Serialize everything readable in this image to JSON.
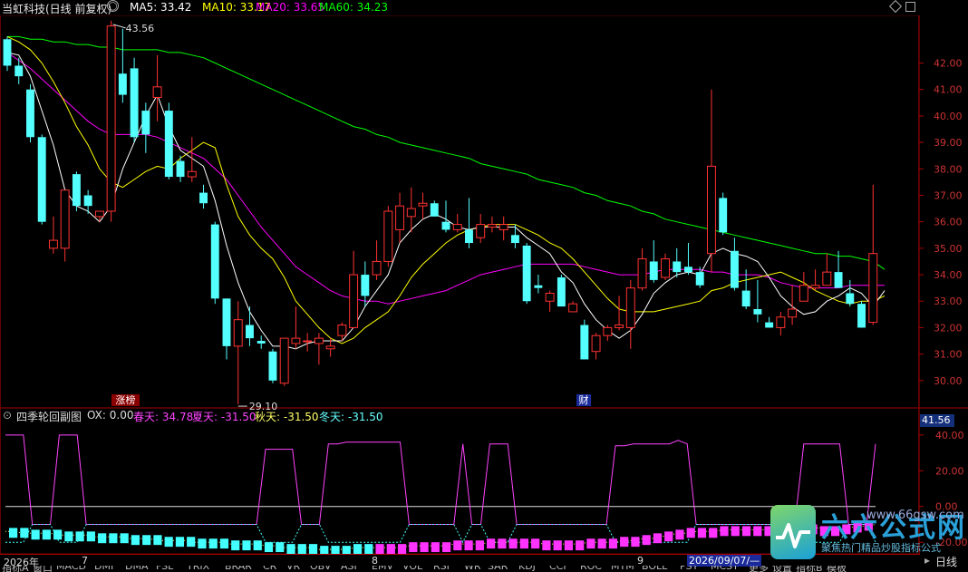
{
  "header": {
    "title": "当虹科技(日线 前复权)",
    "ma": [
      {
        "label": "MA5: 33.42",
        "color": "#ffffff"
      },
      {
        "label": "MA10: 33.17",
        "color": "#ffff00"
      },
      {
        "label": "MA20: 33.65",
        "color": "#ff00ff"
      },
      {
        "label": "MA60: 34.23",
        "color": "#00ff00"
      }
    ]
  },
  "main_axis": {
    "ticks": [
      "42.00",
      "41.00",
      "40.00",
      "39.00",
      "38.00",
      "37.00",
      "36.00",
      "35.00",
      "34.00",
      "33.00",
      "32.00",
      "31.00",
      "30.00"
    ],
    "high_label": "43.56",
    "low_label": "29.10"
  },
  "badges": {
    "zhangbang": "涨榜",
    "cai": "财"
  },
  "sub": {
    "title": "四季轮回副图",
    "ox": "OX: 0.00",
    "spring": "春天: 34.78",
    "summer": "夏天: -31.50",
    "autumn": "秋天: -31.50",
    "winter": "冬天: -31.50",
    "value_badge": "41.56",
    "ticks": [
      "40.00",
      "20.00",
      "0.00",
      "-20.00"
    ]
  },
  "datebar": {
    "year": "2026年",
    "m7": "7",
    "m8": "8",
    "m9": "9",
    "cursor": "2026/09/07/—"
  },
  "period_button": "日线",
  "tabs": [
    "指标A",
    "窗口",
    "MACD",
    "DMI",
    "DMA",
    "FSL",
    "TRIX",
    "BRAR",
    "CR",
    "VR",
    "OBV",
    "ASI",
    "EMV",
    "VOL",
    "RSI",
    "WR",
    "SAR",
    "KDJ",
    "CCI",
    "ROC",
    "MTM",
    "BOLL",
    "PSY",
    "MCST",
    "更多",
    "设置",
    "指标B",
    "模板"
  ],
  "logo": {
    "name": "六六公式网",
    "url": "www.66gsw.com",
    "slogan": "聚焦热门精品炒股指标公式"
  },
  "colors": {
    "up": "#ff3232",
    "down": "#54ffff",
    "ma5": "#ffffff",
    "ma10": "#ffff00",
    "ma20": "#ff00ff",
    "ma60": "#00ff00"
  },
  "chart_data": {
    "type": "candlestick",
    "ylim": [
      29.0,
      43.8
    ],
    "candles": [
      {
        "o": 42.9,
        "h": 43.0,
        "l": 41.7,
        "c": 41.9
      },
      {
        "o": 41.9,
        "h": 42.2,
        "l": 41.2,
        "c": 41.5
      },
      {
        "o": 41.0,
        "h": 41.2,
        "l": 39.0,
        "c": 39.2
      },
      {
        "o": 39.2,
        "h": 39.3,
        "l": 35.9,
        "c": 36.0
      },
      {
        "o": 35.0,
        "h": 36.2,
        "l": 34.8,
        "c": 35.3
      },
      {
        "o": 35.0,
        "h": 37.2,
        "l": 34.5,
        "c": 37.2
      },
      {
        "o": 37.8,
        "h": 37.9,
        "l": 36.4,
        "c": 36.6
      },
      {
        "o": 37.0,
        "h": 37.2,
        "l": 36.3,
        "c": 36.6
      },
      {
        "o": 36.2,
        "h": 36.4,
        "l": 36.0,
        "c": 36.4
      },
      {
        "o": 36.4,
        "h": 43.6,
        "l": 36.0,
        "c": 43.4
      },
      {
        "o": 41.6,
        "h": 43.3,
        "l": 40.5,
        "c": 40.8
      },
      {
        "o": 41.8,
        "h": 42.2,
        "l": 39.0,
        "c": 39.2
      },
      {
        "o": 40.2,
        "h": 40.5,
        "l": 38.6,
        "c": 39.3
      },
      {
        "o": 40.7,
        "h": 42.3,
        "l": 39.8,
        "c": 41.1
      },
      {
        "o": 40.2,
        "h": 40.5,
        "l": 37.6,
        "c": 37.7
      },
      {
        "o": 38.3,
        "h": 38.5,
        "l": 37.5,
        "c": 37.7
      },
      {
        "o": 37.7,
        "h": 39.2,
        "l": 37.5,
        "c": 37.9
      },
      {
        "o": 37.1,
        "h": 37.4,
        "l": 36.5,
        "c": 36.7
      },
      {
        "o": 35.9,
        "h": 36.0,
        "l": 32.9,
        "c": 33.1
      },
      {
        "o": 33.1,
        "h": 33.1,
        "l": 30.8,
        "c": 31.3
      },
      {
        "o": 31.3,
        "h": 33.0,
        "l": 29.1,
        "c": 32.3
      },
      {
        "o": 32.1,
        "h": 32.8,
        "l": 31.3,
        "c": 31.6
      },
      {
        "o": 31.5,
        "h": 31.7,
        "l": 31.2,
        "c": 31.4
      },
      {
        "o": 31.1,
        "h": 31.2,
        "l": 29.9,
        "c": 30.0
      },
      {
        "o": 29.9,
        "h": 31.5,
        "l": 29.8,
        "c": 31.6
      },
      {
        "o": 31.4,
        "h": 32.8,
        "l": 31.2,
        "c": 31.6
      },
      {
        "o": 31.5,
        "h": 31.8,
        "l": 31.1,
        "c": 31.5
      },
      {
        "o": 31.4,
        "h": 31.8,
        "l": 30.6,
        "c": 31.6
      },
      {
        "o": 31.2,
        "h": 31.6,
        "l": 30.9,
        "c": 31.3
      },
      {
        "o": 31.7,
        "h": 32.2,
        "l": 31.5,
        "c": 32.1
      },
      {
        "o": 32.0,
        "h": 34.9,
        "l": 32.0,
        "c": 34.0
      },
      {
        "o": 34.0,
        "h": 34.5,
        "l": 32.8,
        "c": 33.2
      },
      {
        "o": 34.0,
        "h": 35.3,
        "l": 33.8,
        "c": 34.5
      },
      {
        "o": 34.5,
        "h": 36.6,
        "l": 34.3,
        "c": 36.4
      },
      {
        "o": 35.7,
        "h": 37.1,
        "l": 35.2,
        "c": 36.6
      },
      {
        "o": 36.2,
        "h": 37.3,
        "l": 35.6,
        "c": 36.5
      },
      {
        "o": 36.6,
        "h": 37.1,
        "l": 36.1,
        "c": 36.7
      },
      {
        "o": 36.7,
        "h": 36.8,
        "l": 36.2,
        "c": 36.2
      },
      {
        "o": 36.0,
        "h": 36.8,
        "l": 35.6,
        "c": 35.7
      },
      {
        "o": 35.7,
        "h": 36.3,
        "l": 35.6,
        "c": 35.9
      },
      {
        "o": 35.7,
        "h": 36.9,
        "l": 35.0,
        "c": 35.2
      },
      {
        "o": 35.4,
        "h": 36.3,
        "l": 35.2,
        "c": 35.9
      },
      {
        "o": 35.8,
        "h": 36.2,
        "l": 35.6,
        "c": 35.9
      },
      {
        "o": 35.7,
        "h": 36.2,
        "l": 35.3,
        "c": 35.9
      },
      {
        "o": 35.5,
        "h": 35.9,
        "l": 35.0,
        "c": 35.2
      },
      {
        "o": 35.1,
        "h": 35.2,
        "l": 32.9,
        "c": 33.0
      },
      {
        "o": 33.6,
        "h": 34.0,
        "l": 33.3,
        "c": 33.5
      },
      {
        "o": 33.0,
        "h": 33.4,
        "l": 32.6,
        "c": 33.3
      },
      {
        "o": 33.9,
        "h": 34.0,
        "l": 32.8,
        "c": 32.8
      },
      {
        "o": 32.6,
        "h": 33.0,
        "l": 32.6,
        "c": 32.9
      },
      {
        "o": 32.1,
        "h": 32.3,
        "l": 31.0,
        "c": 30.8
      },
      {
        "o": 31.1,
        "h": 31.8,
        "l": 30.8,
        "c": 31.7
      },
      {
        "o": 31.7,
        "h": 32.1,
        "l": 31.5,
        "c": 32.0
      },
      {
        "o": 32.0,
        "h": 33.2,
        "l": 31.9,
        "c": 32.1
      },
      {
        "o": 32.0,
        "h": 33.8,
        "l": 31.2,
        "c": 33.5
      },
      {
        "o": 33.5,
        "h": 35.0,
        "l": 33.4,
        "c": 34.6
      },
      {
        "o": 34.5,
        "h": 35.3,
        "l": 33.7,
        "c": 33.8
      },
      {
        "o": 33.9,
        "h": 34.8,
        "l": 33.8,
        "c": 34.6
      },
      {
        "o": 34.5,
        "h": 35.0,
        "l": 33.9,
        "c": 34.1
      },
      {
        "o": 34.3,
        "h": 35.2,
        "l": 34.0,
        "c": 34.1
      },
      {
        "o": 34.1,
        "h": 34.3,
        "l": 33.5,
        "c": 33.6
      },
      {
        "o": 34.8,
        "h": 41.0,
        "l": 34.1,
        "c": 38.1
      },
      {
        "o": 36.9,
        "h": 37.1,
        "l": 35.5,
        "c": 35.6
      },
      {
        "o": 34.9,
        "h": 35.4,
        "l": 33.4,
        "c": 33.5
      },
      {
        "o": 33.4,
        "h": 34.2,
        "l": 32.7,
        "c": 32.8
      },
      {
        "o": 32.7,
        "h": 33.8,
        "l": 32.2,
        "c": 32.5
      },
      {
        "o": 32.2,
        "h": 32.4,
        "l": 32.0,
        "c": 32.0
      },
      {
        "o": 32.0,
        "h": 32.6,
        "l": 31.7,
        "c": 32.4
      },
      {
        "o": 32.4,
        "h": 33.6,
        "l": 32.1,
        "c": 32.7
      },
      {
        "o": 33.0,
        "h": 34.1,
        "l": 33.0,
        "c": 33.6
      },
      {
        "o": 33.5,
        "h": 34.2,
        "l": 33.4,
        "c": 33.6
      },
      {
        "o": 33.6,
        "h": 34.8,
        "l": 33.6,
        "c": 34.1
      },
      {
        "o": 34.1,
        "h": 34.9,
        "l": 33.7,
        "c": 33.5
      },
      {
        "o": 33.3,
        "h": 33.8,
        "l": 32.8,
        "c": 32.9
      },
      {
        "o": 32.9,
        "h": 33.0,
        "l": 32.0,
        "c": 32.0
      },
      {
        "o": 32.2,
        "h": 37.4,
        "l": 32.1,
        "c": 34.8
      }
    ],
    "ma5": [
      42.4,
      42.3,
      41.5,
      40.2,
      38.9,
      37.2,
      36.6,
      36.4,
      36.0,
      36.6,
      38.0,
      39.0,
      40.0,
      40.8,
      39.6,
      38.7,
      38.4,
      38.1,
      36.8,
      35.1,
      33.7,
      32.6,
      31.9,
      31.3,
      31.3,
      31.2,
      31.4,
      31.5,
      31.5,
      31.5,
      32.0,
      32.8,
      33.4,
      34.0,
      35.2,
      35.7,
      36.1,
      36.3,
      36.1,
      35.8,
      35.7,
      35.8,
      35.8,
      35.8,
      35.8,
      35.4,
      35.1,
      34.8,
      34.1,
      33.7,
      32.9,
      32.3,
      31.9,
      31.6,
      31.9,
      32.5,
      33.3,
      33.7,
      34.0,
      34.1,
      34.0,
      34.8,
      35.0,
      34.8,
      34.7,
      34.5,
      33.9,
      33.2,
      32.8,
      32.5,
      32.6,
      33.0,
      33.2,
      33.5,
      33.3,
      32.8,
      33.4
    ],
    "ma10": [
      43.0,
      42.8,
      42.5,
      42.0,
      41.3,
      40.5,
      39.6,
      38.9,
      38.0,
      37.5,
      37.3,
      37.6,
      37.9,
      38.1,
      38.0,
      38.4,
      38.7,
      39.0,
      38.8,
      37.4,
      36.2,
      35.5,
      35.0,
      34.6,
      33.9,
      33.0,
      32.5,
      32.0,
      31.6,
      31.4,
      31.6,
      32.0,
      32.3,
      32.6,
      33.2,
      33.9,
      34.4,
      34.8,
      35.2,
      35.5,
      35.7,
      35.8,
      35.9,
      35.9,
      35.9,
      35.7,
      35.5,
      35.2,
      35.0,
      34.6,
      34.1,
      33.6,
      33.1,
      32.7,
      32.6,
      32.6,
      32.6,
      32.7,
      32.8,
      32.9,
      33.0,
      33.4,
      33.5,
      33.7,
      33.8,
      33.9,
      34.0,
      34.1,
      33.9,
      33.7,
      33.4,
      33.2,
      33.0,
      32.9,
      33.0,
      33.0,
      33.2
    ],
    "ma20": [
      42.4,
      42.1,
      41.8,
      41.4,
      41.0,
      40.6,
      40.2,
      39.8,
      39.5,
      39.3,
      39.3,
      39.3,
      39.3,
      39.2,
      39.0,
      38.8,
      38.6,
      38.4,
      38.0,
      37.6,
      37.0,
      36.4,
      35.8,
      35.3,
      34.8,
      34.3,
      34.0,
      33.7,
      33.4,
      33.2,
      33.1,
      33.0,
      33.0,
      32.9,
      33.0,
      33.1,
      33.2,
      33.3,
      33.4,
      33.6,
      33.8,
      34.0,
      34.1,
      34.2,
      34.3,
      34.4,
      34.4,
      34.4,
      34.4,
      34.4,
      34.3,
      34.2,
      34.1,
      34.0,
      34.0,
      34.0,
      34.1,
      34.2,
      34.2,
      34.2,
      34.2,
      34.1,
      34.1,
      34.0,
      34.0,
      34.0,
      33.9,
      33.7,
      33.6,
      33.5,
      33.5,
      33.5,
      33.5,
      33.6,
      33.6,
      33.6,
      33.6
    ],
    "ma60": [
      43.0,
      43.0,
      42.9,
      42.9,
      42.8,
      42.8,
      42.7,
      42.7,
      42.6,
      42.6,
      42.5,
      42.5,
      42.5,
      42.5,
      42.4,
      42.4,
      42.3,
      42.2,
      42.0,
      41.8,
      41.6,
      41.4,
      41.2,
      41.0,
      40.8,
      40.6,
      40.4,
      40.2,
      40.0,
      39.8,
      39.6,
      39.5,
      39.3,
      39.2,
      39.0,
      38.9,
      38.8,
      38.7,
      38.6,
      38.5,
      38.4,
      38.2,
      38.1,
      38.0,
      37.9,
      37.8,
      37.6,
      37.5,
      37.4,
      37.3,
      37.1,
      37.0,
      36.8,
      36.7,
      36.6,
      36.4,
      36.3,
      36.1,
      36.0,
      35.9,
      35.8,
      35.7,
      35.6,
      35.5,
      35.4,
      35.3,
      35.2,
      35.1,
      35.0,
      34.9,
      34.8,
      34.8,
      34.7,
      34.7,
      34.6,
      34.5,
      34.2
    ],
    "sub": {
      "ylim": [
        -26,
        45
      ],
      "spring": [
        40,
        40,
        40,
        0,
        0,
        0,
        40,
        40,
        40,
        0,
        0,
        0,
        0,
        0,
        0,
        0,
        0,
        0,
        0,
        0,
        0,
        0,
        0,
        0,
        0,
        0,
        0,
        0,
        0,
        32,
        32,
        32,
        32,
        0,
        0,
        0,
        35,
        35,
        36,
        36,
        36,
        36,
        36,
        36,
        36,
        0,
        0,
        0,
        0,
        0,
        0,
        35,
        0,
        0,
        35,
        35,
        35,
        0,
        0,
        0,
        0,
        0,
        0,
        0,
        0,
        0,
        0,
        0,
        34,
        34,
        35,
        35,
        35,
        35,
        35,
        37,
        35,
        0,
        0,
        0,
        0,
        0,
        0,
        0,
        0,
        0,
        0,
        0,
        0,
        35,
        35,
        35,
        35,
        35,
        0,
        0,
        0,
        35
      ],
      "base_cyan": -10,
      "base_yellow": -20,
      "hist": [
        -16,
        -16,
        -17,
        -17,
        -17,
        -18,
        -18,
        -18,
        -19,
        -19,
        -19,
        -20,
        -20,
        -20,
        -21,
        -21,
        -21,
        -22,
        -22,
        -22,
        -23,
        -23,
        -23,
        -24,
        -24,
        -25,
        -25,
        -25,
        -26,
        -26,
        -26,
        -25,
        -25,
        -25,
        -25,
        -25,
        -24,
        -24,
        -24,
        -24,
        -23,
        -23,
        -23,
        -22,
        -22,
        -22,
        -22,
        -22,
        -23,
        -23,
        -23,
        -23,
        -22,
        -22,
        -22,
        -21,
        -21,
        -20,
        -19,
        -18,
        -17,
        -16,
        -16,
        -16,
        -15,
        -15,
        -15,
        -15,
        -15,
        -14,
        -14,
        -14,
        -14,
        -15,
        -15,
        -14,
        -13,
        -12
      ]
    }
  }
}
